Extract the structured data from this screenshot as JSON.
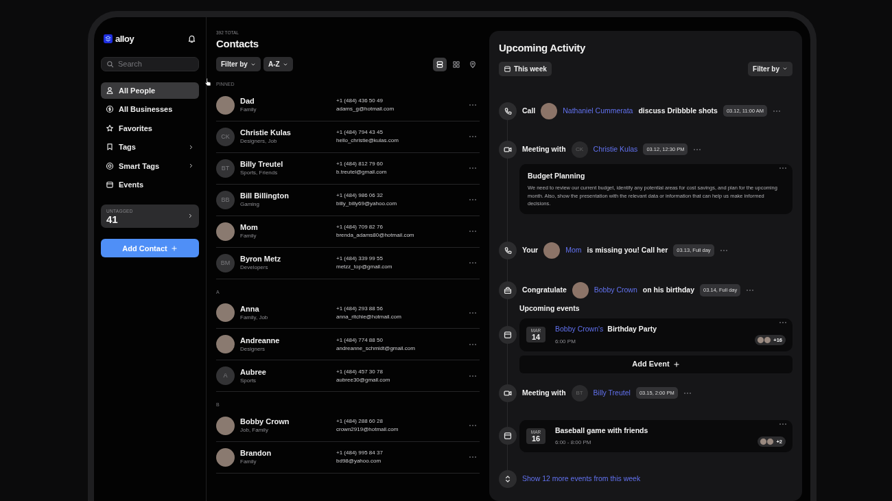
{
  "sidebar": {
    "logo": "alloy",
    "search": {
      "placeholder": "Search"
    },
    "nav": [
      {
        "label": "All People",
        "selected": true,
        "chevron": false
      },
      {
        "label": "All Businesses",
        "selected": false,
        "chevron": false
      },
      {
        "label": "Favorites",
        "selected": false,
        "chevron": false
      },
      {
        "label": "Tags",
        "selected": false,
        "chevron": true
      },
      {
        "label": "Smart Tags",
        "selected": false,
        "chevron": true
      },
      {
        "label": "Events",
        "selected": false,
        "chevron": false
      }
    ],
    "untagged": {
      "label": "UNTAGGED",
      "count": "41"
    },
    "add_button": "Add Contact"
  },
  "contacts": {
    "total": "392 TOTAL",
    "title": "Contacts",
    "filters": [
      "Filter by",
      "A-Z"
    ],
    "views": [
      {
        "selected": true
      },
      {
        "selected": false
      },
      {
        "selected": false
      }
    ],
    "groups": [
      {
        "label": "PINNED",
        "contacts": [
          {
            "name": "Dad",
            "tags": "Family",
            "phone": "+1 (484) 436 50 49",
            "email": "adams_g@hotmail.com"
          },
          {
            "name": "Christie Kulas",
            "tags": "Designers, Job",
            "phone": "+1 (484) 794 43 45",
            "email": "hello_christie@kulas.com",
            "initials": "CK"
          },
          {
            "name": "Billy Treutel",
            "tags": "Sports, Friends",
            "phone": "+1 (484) 812 79 60",
            "email": "b.treutel@gmail.com",
            "initials": "BT"
          },
          {
            "name": "Bill Billington",
            "tags": "Gaming",
            "phone": "+1 (484) 986 06 32",
            "email": "billy_billy69@yahoo.com",
            "initials": "BB"
          },
          {
            "name": "Mom",
            "tags": "Family",
            "phone": "+1 (484) 709 82 76",
            "email": "brenda_adams80@hotmail.com"
          },
          {
            "name": "Byron Metz",
            "tags": "Developers",
            "phone": "+1 (484) 339 99 55",
            "email": "metzz_top@gmail.com",
            "initials": "BM"
          }
        ]
      },
      {
        "label": "A",
        "contacts": [
          {
            "name": "Anna",
            "tags": "Family, Job",
            "phone": "+1 (484) 293 88 56",
            "email": "anna_ritchie@hotmail.com"
          },
          {
            "name": "Andreanne",
            "tags": "Designers",
            "phone": "+1 (484) 774 88 50",
            "email": "andreanne_schmidt@gmail.com"
          },
          {
            "name": "Aubree",
            "tags": "Sports",
            "phone": "+1 (484) 457 30 78",
            "email": "aubree30@gmail.com",
            "initials": "A"
          }
        ]
      },
      {
        "label": "B",
        "contacts": [
          {
            "name": "Bobby Crown",
            "tags": "Job, Family",
            "phone": "+1 (484) 288 60 28",
            "email": "crown2919@hotmail.com"
          },
          {
            "name": "Brandon",
            "tags": "Family",
            "phone": "+1 (484) 995 84 37",
            "email": "bd98@yahoo.com"
          }
        ]
      }
    ]
  },
  "activity": {
    "title": "Upcoming Activity",
    "range": "This week",
    "filter": "Filter by",
    "timeline": [
      {
        "kind": "call",
        "time": "03.12, 11:00 AM",
        "parts": [
          {
            "kind": "text",
            "text": "Call"
          },
          {
            "kind": "photo"
          },
          {
            "kind": "link",
            "text": "Nathaniel Cummerata"
          },
          {
            "kind": "text",
            "text": "discuss Dribbble shots"
          }
        ]
      },
      {
        "kind": "meeting",
        "time": "03.12, 12:30 PM",
        "parts": [
          {
            "kind": "text",
            "text": "Meeting with"
          },
          {
            "kind": "initials",
            "text": "CK"
          },
          {
            "kind": "link",
            "text": "Christie Kulas"
          }
        ],
        "note": {
          "title": "Budget Planning",
          "body": "We need to review our current budget, identify any potential areas for cost savings, and plan for the upcoming month. Also, show the presentation with the relevant data or information that can help us make informed decisions."
        }
      },
      {
        "kind": "call",
        "time": "03.13, Full day",
        "parts": [
          {
            "kind": "text",
            "text": "Your"
          },
          {
            "kind": "photo"
          },
          {
            "kind": "link",
            "text": "Mom"
          },
          {
            "kind": "text",
            "text": "is missing you! Call her"
          }
        ]
      },
      {
        "kind": "birthday",
        "time": "03.14, Full day",
        "parts": [
          {
            "kind": "text",
            "text": "Congratulate"
          },
          {
            "kind": "photo"
          },
          {
            "kind": "link",
            "text": "Bobby Crown"
          },
          {
            "kind": "text",
            "text": "on his birthday"
          }
        ]
      },
      {
        "kind": "heading",
        "text": "Upcoming events"
      },
      {
        "kind": "event",
        "month": "MAR",
        "day": "14",
        "parts": [
          {
            "kind": "link",
            "text": "Bobby Crown's"
          },
          {
            "kind": "text",
            "text": "Birthday Party"
          }
        ],
        "time": "6:00 PM",
        "extra": "+16"
      },
      {
        "kind": "add",
        "text": "Add Event"
      },
      {
        "kind": "meeting",
        "time": "03.15, 2:00 PM",
        "parts": [
          {
            "kind": "text",
            "text": "Meeting with"
          },
          {
            "kind": "initials",
            "text": "BT"
          },
          {
            "kind": "link",
            "text": "Billy Treutel"
          }
        ]
      },
      {
        "kind": "event",
        "month": "MAR",
        "day": "16",
        "parts": [
          {
            "kind": "text",
            "text": "Baseball game with friends"
          }
        ],
        "time": "6:00 - 8:00 PM",
        "extra": "+2"
      },
      {
        "kind": "more",
        "text": "Show 12 more events from this week"
      }
    ]
  }
}
